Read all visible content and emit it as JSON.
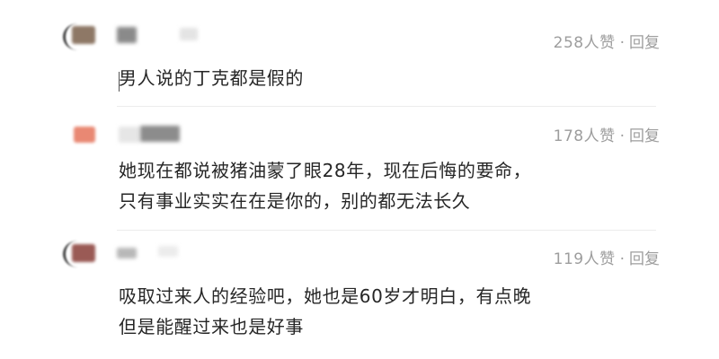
{
  "comments": [
    {
      "likes": "258人赞",
      "dot": "·",
      "reply": "回复",
      "lines": [
        "男人说的丁克都是假的"
      ],
      "avatar_color": "#8e7866"
    },
    {
      "likes": "178人赞",
      "dot": "·",
      "reply": "回复",
      "lines": [
        "她现在都说被猪油蒙了眼28年，现在后悔的要命，",
        "只有事业实实在在是你的，别的都无法长久"
      ],
      "avatar_color": "#e98873"
    },
    {
      "likes": "119人赞",
      "dot": "·",
      "reply": "回复",
      "lines": [
        "吸取过来人的经验吧，她也是60岁才明白，有点晚",
        "但是能醒过来也是好事"
      ],
      "avatar_color": "#9a5a55"
    }
  ]
}
